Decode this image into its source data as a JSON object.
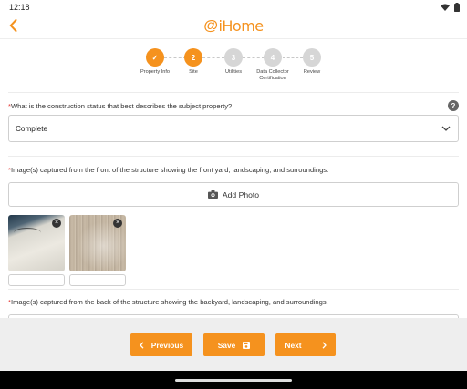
{
  "status": {
    "time": "12:18"
  },
  "appbar": {
    "logo_at": "@",
    "logo_name": "iHome"
  },
  "stepper": {
    "steps": [
      {
        "number": "✓",
        "label": "Property Info",
        "state": "done"
      },
      {
        "number": "2",
        "label": "Site",
        "state": "active"
      },
      {
        "number": "3",
        "label": "Utilities",
        "state": "todo"
      },
      {
        "number": "4",
        "label": "Data Collector Certification",
        "state": "todo"
      },
      {
        "number": "5",
        "label": "Review",
        "state": "todo"
      }
    ]
  },
  "form": {
    "construction": {
      "required_mark": "*",
      "question": "What is the construction status that best describes the subject property?",
      "value": "Complete",
      "help": "?"
    },
    "front_images": {
      "required_mark": "*",
      "question": "Image(s) captured from the front of the structure showing the front yard, landscaping, and surroundings.",
      "add_label": "Add Photo",
      "remove_glyph": "×"
    },
    "back_images": {
      "required_mark": "*",
      "question": "Image(s) captured from the back of the structure showing the backyard, landscaping, and surroundings."
    }
  },
  "footer": {
    "previous_label": "Previous",
    "save_label": "Save",
    "next_label": "Next"
  },
  "colors": {
    "accent": "#f5921e",
    "required": "#e53935"
  }
}
